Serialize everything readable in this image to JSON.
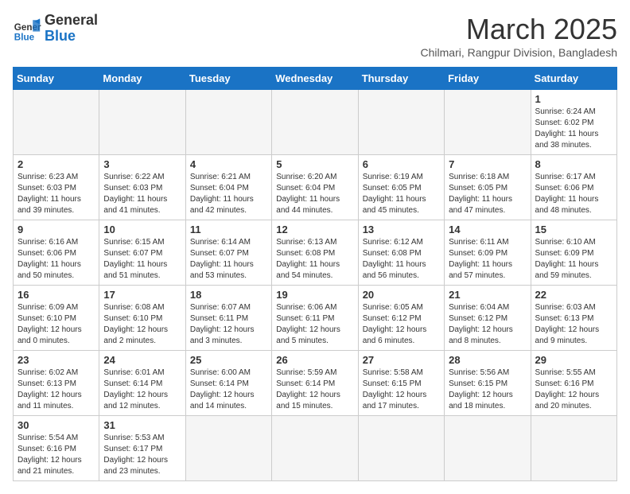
{
  "header": {
    "logo_general": "General",
    "logo_blue": "Blue",
    "month_title": "March 2025",
    "location": "Chilmari, Rangpur Division, Bangladesh"
  },
  "weekdays": [
    "Sunday",
    "Monday",
    "Tuesday",
    "Wednesday",
    "Thursday",
    "Friday",
    "Saturday"
  ],
  "weeks": [
    [
      {
        "day": "",
        "info": ""
      },
      {
        "day": "",
        "info": ""
      },
      {
        "day": "",
        "info": ""
      },
      {
        "day": "",
        "info": ""
      },
      {
        "day": "",
        "info": ""
      },
      {
        "day": "",
        "info": ""
      },
      {
        "day": "1",
        "info": "Sunrise: 6:24 AM\nSunset: 6:02 PM\nDaylight: 11 hours and 38 minutes."
      }
    ],
    [
      {
        "day": "2",
        "info": "Sunrise: 6:23 AM\nSunset: 6:03 PM\nDaylight: 11 hours and 39 minutes."
      },
      {
        "day": "3",
        "info": "Sunrise: 6:22 AM\nSunset: 6:03 PM\nDaylight: 11 hours and 41 minutes."
      },
      {
        "day": "4",
        "info": "Sunrise: 6:21 AM\nSunset: 6:04 PM\nDaylight: 11 hours and 42 minutes."
      },
      {
        "day": "5",
        "info": "Sunrise: 6:20 AM\nSunset: 6:04 PM\nDaylight: 11 hours and 44 minutes."
      },
      {
        "day": "6",
        "info": "Sunrise: 6:19 AM\nSunset: 6:05 PM\nDaylight: 11 hours and 45 minutes."
      },
      {
        "day": "7",
        "info": "Sunrise: 6:18 AM\nSunset: 6:05 PM\nDaylight: 11 hours and 47 minutes."
      },
      {
        "day": "8",
        "info": "Sunrise: 6:17 AM\nSunset: 6:06 PM\nDaylight: 11 hours and 48 minutes."
      }
    ],
    [
      {
        "day": "9",
        "info": "Sunrise: 6:16 AM\nSunset: 6:06 PM\nDaylight: 11 hours and 50 minutes."
      },
      {
        "day": "10",
        "info": "Sunrise: 6:15 AM\nSunset: 6:07 PM\nDaylight: 11 hours and 51 minutes."
      },
      {
        "day": "11",
        "info": "Sunrise: 6:14 AM\nSunset: 6:07 PM\nDaylight: 11 hours and 53 minutes."
      },
      {
        "day": "12",
        "info": "Sunrise: 6:13 AM\nSunset: 6:08 PM\nDaylight: 11 hours and 54 minutes."
      },
      {
        "day": "13",
        "info": "Sunrise: 6:12 AM\nSunset: 6:08 PM\nDaylight: 11 hours and 56 minutes."
      },
      {
        "day": "14",
        "info": "Sunrise: 6:11 AM\nSunset: 6:09 PM\nDaylight: 11 hours and 57 minutes."
      },
      {
        "day": "15",
        "info": "Sunrise: 6:10 AM\nSunset: 6:09 PM\nDaylight: 11 hours and 59 minutes."
      }
    ],
    [
      {
        "day": "16",
        "info": "Sunrise: 6:09 AM\nSunset: 6:10 PM\nDaylight: 12 hours and 0 minutes."
      },
      {
        "day": "17",
        "info": "Sunrise: 6:08 AM\nSunset: 6:10 PM\nDaylight: 12 hours and 2 minutes."
      },
      {
        "day": "18",
        "info": "Sunrise: 6:07 AM\nSunset: 6:11 PM\nDaylight: 12 hours and 3 minutes."
      },
      {
        "day": "19",
        "info": "Sunrise: 6:06 AM\nSunset: 6:11 PM\nDaylight: 12 hours and 5 minutes."
      },
      {
        "day": "20",
        "info": "Sunrise: 6:05 AM\nSunset: 6:12 PM\nDaylight: 12 hours and 6 minutes."
      },
      {
        "day": "21",
        "info": "Sunrise: 6:04 AM\nSunset: 6:12 PM\nDaylight: 12 hours and 8 minutes."
      },
      {
        "day": "22",
        "info": "Sunrise: 6:03 AM\nSunset: 6:13 PM\nDaylight: 12 hours and 9 minutes."
      }
    ],
    [
      {
        "day": "23",
        "info": "Sunrise: 6:02 AM\nSunset: 6:13 PM\nDaylight: 12 hours and 11 minutes."
      },
      {
        "day": "24",
        "info": "Sunrise: 6:01 AM\nSunset: 6:14 PM\nDaylight: 12 hours and 12 minutes."
      },
      {
        "day": "25",
        "info": "Sunrise: 6:00 AM\nSunset: 6:14 PM\nDaylight: 12 hours and 14 minutes."
      },
      {
        "day": "26",
        "info": "Sunrise: 5:59 AM\nSunset: 6:14 PM\nDaylight: 12 hours and 15 minutes."
      },
      {
        "day": "27",
        "info": "Sunrise: 5:58 AM\nSunset: 6:15 PM\nDaylight: 12 hours and 17 minutes."
      },
      {
        "day": "28",
        "info": "Sunrise: 5:56 AM\nSunset: 6:15 PM\nDaylight: 12 hours and 18 minutes."
      },
      {
        "day": "29",
        "info": "Sunrise: 5:55 AM\nSunset: 6:16 PM\nDaylight: 12 hours and 20 minutes."
      }
    ],
    [
      {
        "day": "30",
        "info": "Sunrise: 5:54 AM\nSunset: 6:16 PM\nDaylight: 12 hours and 21 minutes."
      },
      {
        "day": "31",
        "info": "Sunrise: 5:53 AM\nSunset: 6:17 PM\nDaylight: 12 hours and 23 minutes."
      },
      {
        "day": "",
        "info": ""
      },
      {
        "day": "",
        "info": ""
      },
      {
        "day": "",
        "info": ""
      },
      {
        "day": "",
        "info": ""
      },
      {
        "day": "",
        "info": ""
      }
    ]
  ]
}
